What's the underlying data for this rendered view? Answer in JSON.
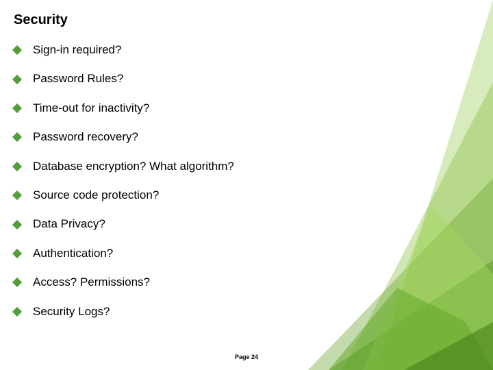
{
  "title": "Security",
  "bullets": [
    "Sign-in required?",
    "Password Rules?",
    "Time-out for inactivity?",
    "Password recovery?",
    "Database encryption? What algorithm?",
    "Source code protection?",
    "Data Privacy?",
    "Authentication?",
    "Access? Permissions?",
    "Security Logs?"
  ],
  "footer": "Page 24"
}
